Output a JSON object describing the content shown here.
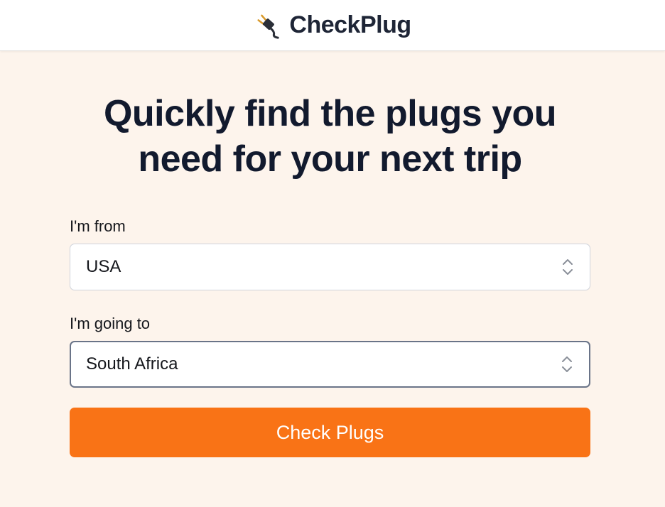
{
  "header": {
    "brand_name": "CheckPlug",
    "brand_icon": "electric-plug-icon"
  },
  "main": {
    "headline_line1": "Quickly find the plugs you",
    "headline_line2": "need for your next trip",
    "from": {
      "label": "I'm from",
      "selected": "USA"
    },
    "to": {
      "label": "I'm going to",
      "selected": "South Africa"
    },
    "submit_label": "Check Plugs"
  },
  "colors": {
    "page_background": "#fdf4ec",
    "header_background": "#ffffff",
    "accent": "#f97316",
    "headline_text": "#121a2e"
  }
}
